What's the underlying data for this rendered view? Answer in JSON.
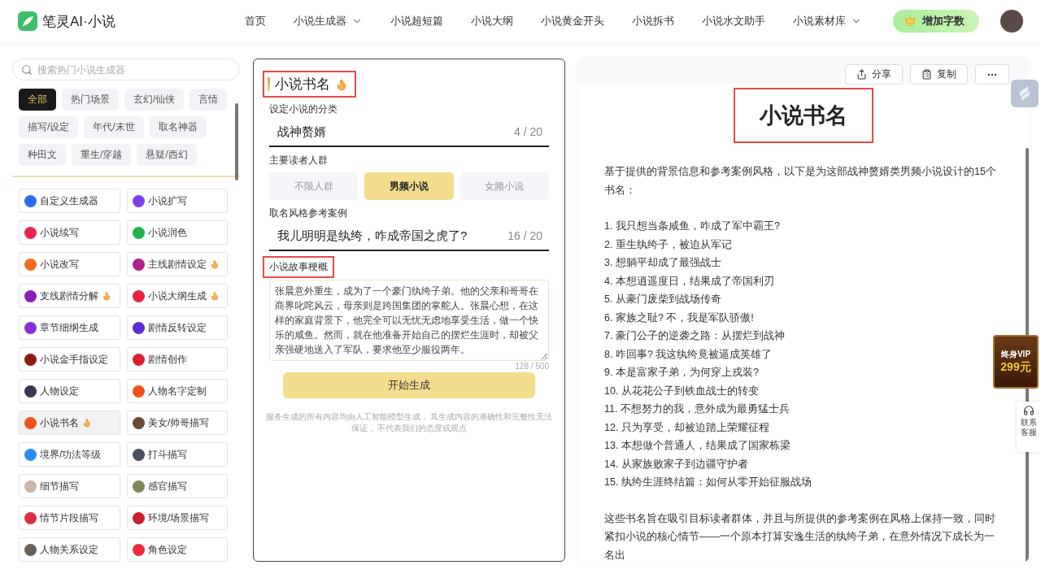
{
  "brand": {
    "name": "笔灵AI·小说"
  },
  "nav": [
    {
      "label": "首页",
      "dropdown": false
    },
    {
      "label": "小说生成器",
      "dropdown": true
    },
    {
      "label": "小说超短篇",
      "dropdown": false
    },
    {
      "label": "小说大纲",
      "dropdown": false
    },
    {
      "label": "小说黄金开头",
      "dropdown": false
    },
    {
      "label": "小说拆书",
      "dropdown": false
    },
    {
      "label": "小说水文助手",
      "dropdown": false
    },
    {
      "label": "小说素材库",
      "dropdown": true
    }
  ],
  "add_words_button": "增加字数",
  "sidebar": {
    "search": {
      "placeholder": "搜索热门小说生成器"
    },
    "categories": [
      {
        "label": "全部",
        "selected": true
      },
      {
        "label": "热门场景",
        "selected": false
      },
      {
        "label": "玄幻/仙侠",
        "selected": false
      },
      {
        "label": "言情",
        "selected": false
      },
      {
        "label": "描写/设定",
        "selected": false
      },
      {
        "label": "年代/末世",
        "selected": false
      },
      {
        "label": "取名神器",
        "selected": false
      },
      {
        "label": "种田文",
        "selected": false
      },
      {
        "label": "重生/穿越",
        "selected": false
      },
      {
        "label": "悬疑/西幻",
        "selected": false
      }
    ],
    "items": [
      {
        "label": "自定义生成器",
        "color": "#2f6bf0",
        "hot": false,
        "selected": false
      },
      {
        "label": "小说扩写",
        "color": "#7b3ff2",
        "hot": false,
        "selected": false
      },
      {
        "label": "小说续写",
        "color": "#e8244f",
        "hot": false,
        "selected": false
      },
      {
        "label": "小说润色",
        "color": "#21b34a",
        "hot": false,
        "selected": false
      },
      {
        "label": "小说改写",
        "color": "#f26a1b",
        "hot": false,
        "selected": false
      },
      {
        "label": "主线剧情设定",
        "color": "#b0218f",
        "hot": true,
        "selected": false
      },
      {
        "label": "支线剧情分解",
        "color": "#8a1fb8",
        "hot": true,
        "selected": false
      },
      {
        "label": "小说大纲生成",
        "color": "#e52440",
        "hot": true,
        "selected": false
      },
      {
        "label": "章节细纲生成",
        "color": "#8a2fd6",
        "hot": false,
        "selected": false
      },
      {
        "label": "剧情反转设定",
        "color": "#5a2fd0",
        "hot": false,
        "selected": false
      },
      {
        "label": "小说金手指设定",
        "color": "#8c1a12",
        "hot": false,
        "selected": false
      },
      {
        "label": "剧情创作",
        "color": "#d8222c",
        "hot": false,
        "selected": false
      },
      {
        "label": "人物设定",
        "color": "#3a3550",
        "hot": false,
        "selected": false
      },
      {
        "label": "人物名字定制",
        "color": "#f0521e",
        "hot": false,
        "selected": false
      },
      {
        "label": "小说书名",
        "color": "#f2531b",
        "hot": true,
        "selected": true
      },
      {
        "label": "美女/帅哥描写",
        "color": "#6b4a38",
        "hot": false,
        "selected": false
      },
      {
        "label": "境界/功法等级",
        "color": "#2a8ef0",
        "hot": false,
        "selected": false
      },
      {
        "label": "打斗描写",
        "color": "#4a5060",
        "hot": false,
        "selected": false
      },
      {
        "label": "细节描写",
        "color": "#c9b8a8",
        "hot": false,
        "selected": false
      },
      {
        "label": "感官描写",
        "color": "#7a8a50",
        "hot": false,
        "selected": false
      },
      {
        "label": "情节片段描写",
        "color": "#d8303c",
        "hot": false,
        "selected": false
      },
      {
        "label": "环境/场景描写",
        "color": "#c8202c",
        "hot": false,
        "selected": false
      },
      {
        "label": "人物关系设定",
        "color": "#6a6058",
        "hot": false,
        "selected": false
      },
      {
        "label": "角色设定",
        "color": "#ee2a3a",
        "hot": false,
        "selected": false
      }
    ]
  },
  "form": {
    "title": "小说书名",
    "title_highlighted": true,
    "category": {
      "label": "设定小说的分类",
      "value": "战神赘婿",
      "count": "4 / 20"
    },
    "audience": {
      "label": "主要读者人群",
      "options": [
        {
          "label": "不限人群",
          "selected": false
        },
        {
          "label": "男频小说",
          "selected": true
        },
        {
          "label": "女频小说",
          "selected": false
        }
      ]
    },
    "reference": {
      "label": "取名风格参考案例",
      "value": "我儿明明是纨绔，咋成帝国之虎了?",
      "count": "16 / 20"
    },
    "synopsis": {
      "label": "小说故事梗概",
      "label_highlighted": true,
      "value": "张晨意外重生，成为了一个豪门纨绔子弟。他的父亲和哥哥在商界叱咤风云，母亲则是跨国集团的掌舵人。张晨心想，在这样的家庭背景下，他完全可以无忧无虑地享受生活，做一个快乐的咸鱼。然而，就在他准备开始自己的摆烂生涯时，却被父亲强硬地送入了军队，要求他至少服役两年。",
      "count": "128 / 500"
    },
    "generate_button": "开始生成",
    "disclaimer": "服务生成的所有内容均由人工智能模型生成， 其生成内容的准确性和完整性无法保证， 不代表我们的态度或观点"
  },
  "result": {
    "toolbar": [
      {
        "label": "分享",
        "kind": "share"
      },
      {
        "label": "复制",
        "kind": "copy"
      },
      {
        "kind": "more"
      }
    ],
    "title": "小说书名",
    "title_highlighted": true,
    "intro": "基于提供的背景信息和参考案例风格，以下是为这部战神赘婿类男频小说设计的15个书名：",
    "names": [
      "1. 我只想当条咸鱼，咋成了军中霸王?",
      "2. 重生纨绔子，被迫从军记",
      "3. 想躺平却成了最强战士",
      "4. 本想逍遥度日，结果成了帝国利刃",
      "5. 从豪门废柴到战场传奇",
      "6. 家族之耻? 不，我是军队骄傲!",
      "7. 豪门公子的逆袭之路：从摆烂到战神",
      "8. 咋回事? 我这纨绔竟被逼成英雄了",
      "9. 本是富家子弟，为何穿上戎装?",
      "10. 从花花公子到铁血战士的转变",
      "11. 不想努力的我，意外成为最勇猛士兵",
      "12. 只为享受，却被迫踏上荣耀征程",
      "13. 本想做个普通人，结果成了国家栋梁",
      "14. 从家族败家子到边疆守护者",
      "15. 纨绔生涯终结篇：如何从零开始征服战场"
    ],
    "outro": "这些书名旨在吸引目标读者群体，并且与所提供的参考案例在风格上保持一致，同时紧扣小说的核心情节——一个原本打算安逸生活的纨绔子弟，在意外情况下成长为一名出"
  },
  "vip_badge": {
    "line1": "终身VIP",
    "line2": "299元"
  },
  "contact": {
    "label": "联系客服"
  }
}
